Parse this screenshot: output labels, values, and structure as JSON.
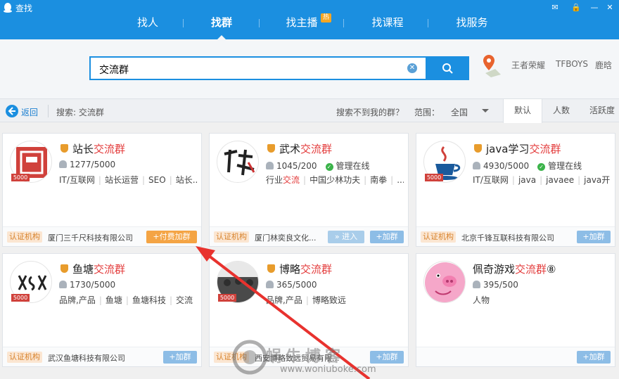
{
  "window": {
    "title": "查找"
  },
  "nav": {
    "items": [
      {
        "label": "找人"
      },
      {
        "label": "找群"
      },
      {
        "label": "找主播",
        "badge": "热"
      },
      {
        "label": "找课程"
      },
      {
        "label": "找服务"
      }
    ],
    "active": "找群"
  },
  "search": {
    "value": "交流群",
    "hot_words": [
      "王者荣耀",
      "TFBOYS",
      "鹿晗"
    ]
  },
  "filter": {
    "back_label": "返回",
    "search_echo": "搜索: 交流群",
    "not_found_link": "搜索不到我的群？",
    "range_label": "范围：",
    "range_value": "全国",
    "sort_tabs": [
      "默认",
      "人数",
      "活跃度"
    ],
    "sort_active": "默认"
  },
  "groups": [
    {
      "name_prefix": "站长",
      "name_hl": "交流群",
      "name_suffix": "",
      "members": "1277/5000",
      "online": "",
      "tags": [
        "IT/互联网",
        "站长运营",
        "SEO",
        "站长..."
      ],
      "level": "5000",
      "cert": "认证机构",
      "org": "厦门三千尺科技有限公司",
      "buttons": [
        "+付费加群"
      ]
    },
    {
      "name_prefix": "武术",
      "name_hl": "交流群",
      "name_suffix": "",
      "members": "1045/200",
      "online": "管理在线",
      "tags_html": [
        "行业",
        "交流"
      ],
      "tags": [
        "行业交流",
        "中国少林功夫",
        "南拳",
        "..."
      ],
      "level": "",
      "cert": "认证机构",
      "org": "厦门林奕良文化...",
      "buttons": [
        "» 进入",
        "+加群"
      ]
    },
    {
      "name_prefix": "java学习",
      "name_hl": "交流群",
      "name_suffix": "",
      "members": "4930/5000",
      "online": "管理在线",
      "tags": [
        "IT/互联网",
        "java",
        "javaee",
        "java开..."
      ],
      "level": "5000",
      "cert": "认证机构",
      "org": "北京千锋互联科技有限公司",
      "buttons": [
        "+加群"
      ]
    },
    {
      "name_prefix": "鱼塘",
      "name_hl": "交流群",
      "name_suffix": "",
      "members": "1730/5000",
      "online": "",
      "tags": [
        "品牌,产品",
        "鱼塘",
        "鱼塘科技",
        "交流"
      ],
      "level": "5000",
      "cert": "认证机构",
      "org": "武汉鱼塘科技有限公司",
      "buttons": [
        "+加群"
      ]
    },
    {
      "name_prefix": "博略",
      "name_hl": "交流群",
      "name_suffix": "",
      "members": "365/5000",
      "online": "",
      "tags": [
        "品牌,产品",
        "博略致远"
      ],
      "level": "5000",
      "cert": "认证机构",
      "org": "西安博略致远贸易有限...",
      "buttons": [
        "+加群"
      ]
    },
    {
      "name_prefix": "佩奇游戏",
      "name_hl": "交流群",
      "name_suffix": "⑧",
      "members": "395/500",
      "online": "",
      "tags": [
        "人物"
      ],
      "level": "",
      "cert": "",
      "org": "",
      "buttons": [
        "+加群"
      ]
    }
  ],
  "watermark": {
    "text": "蜗牛博客",
    "url": "www.woniuboke.com"
  },
  "colors": {
    "accent": "#1b8fe0",
    "highlight": "#e33b3b",
    "paid": "#f4a444",
    "arrow": "#e8322e"
  }
}
